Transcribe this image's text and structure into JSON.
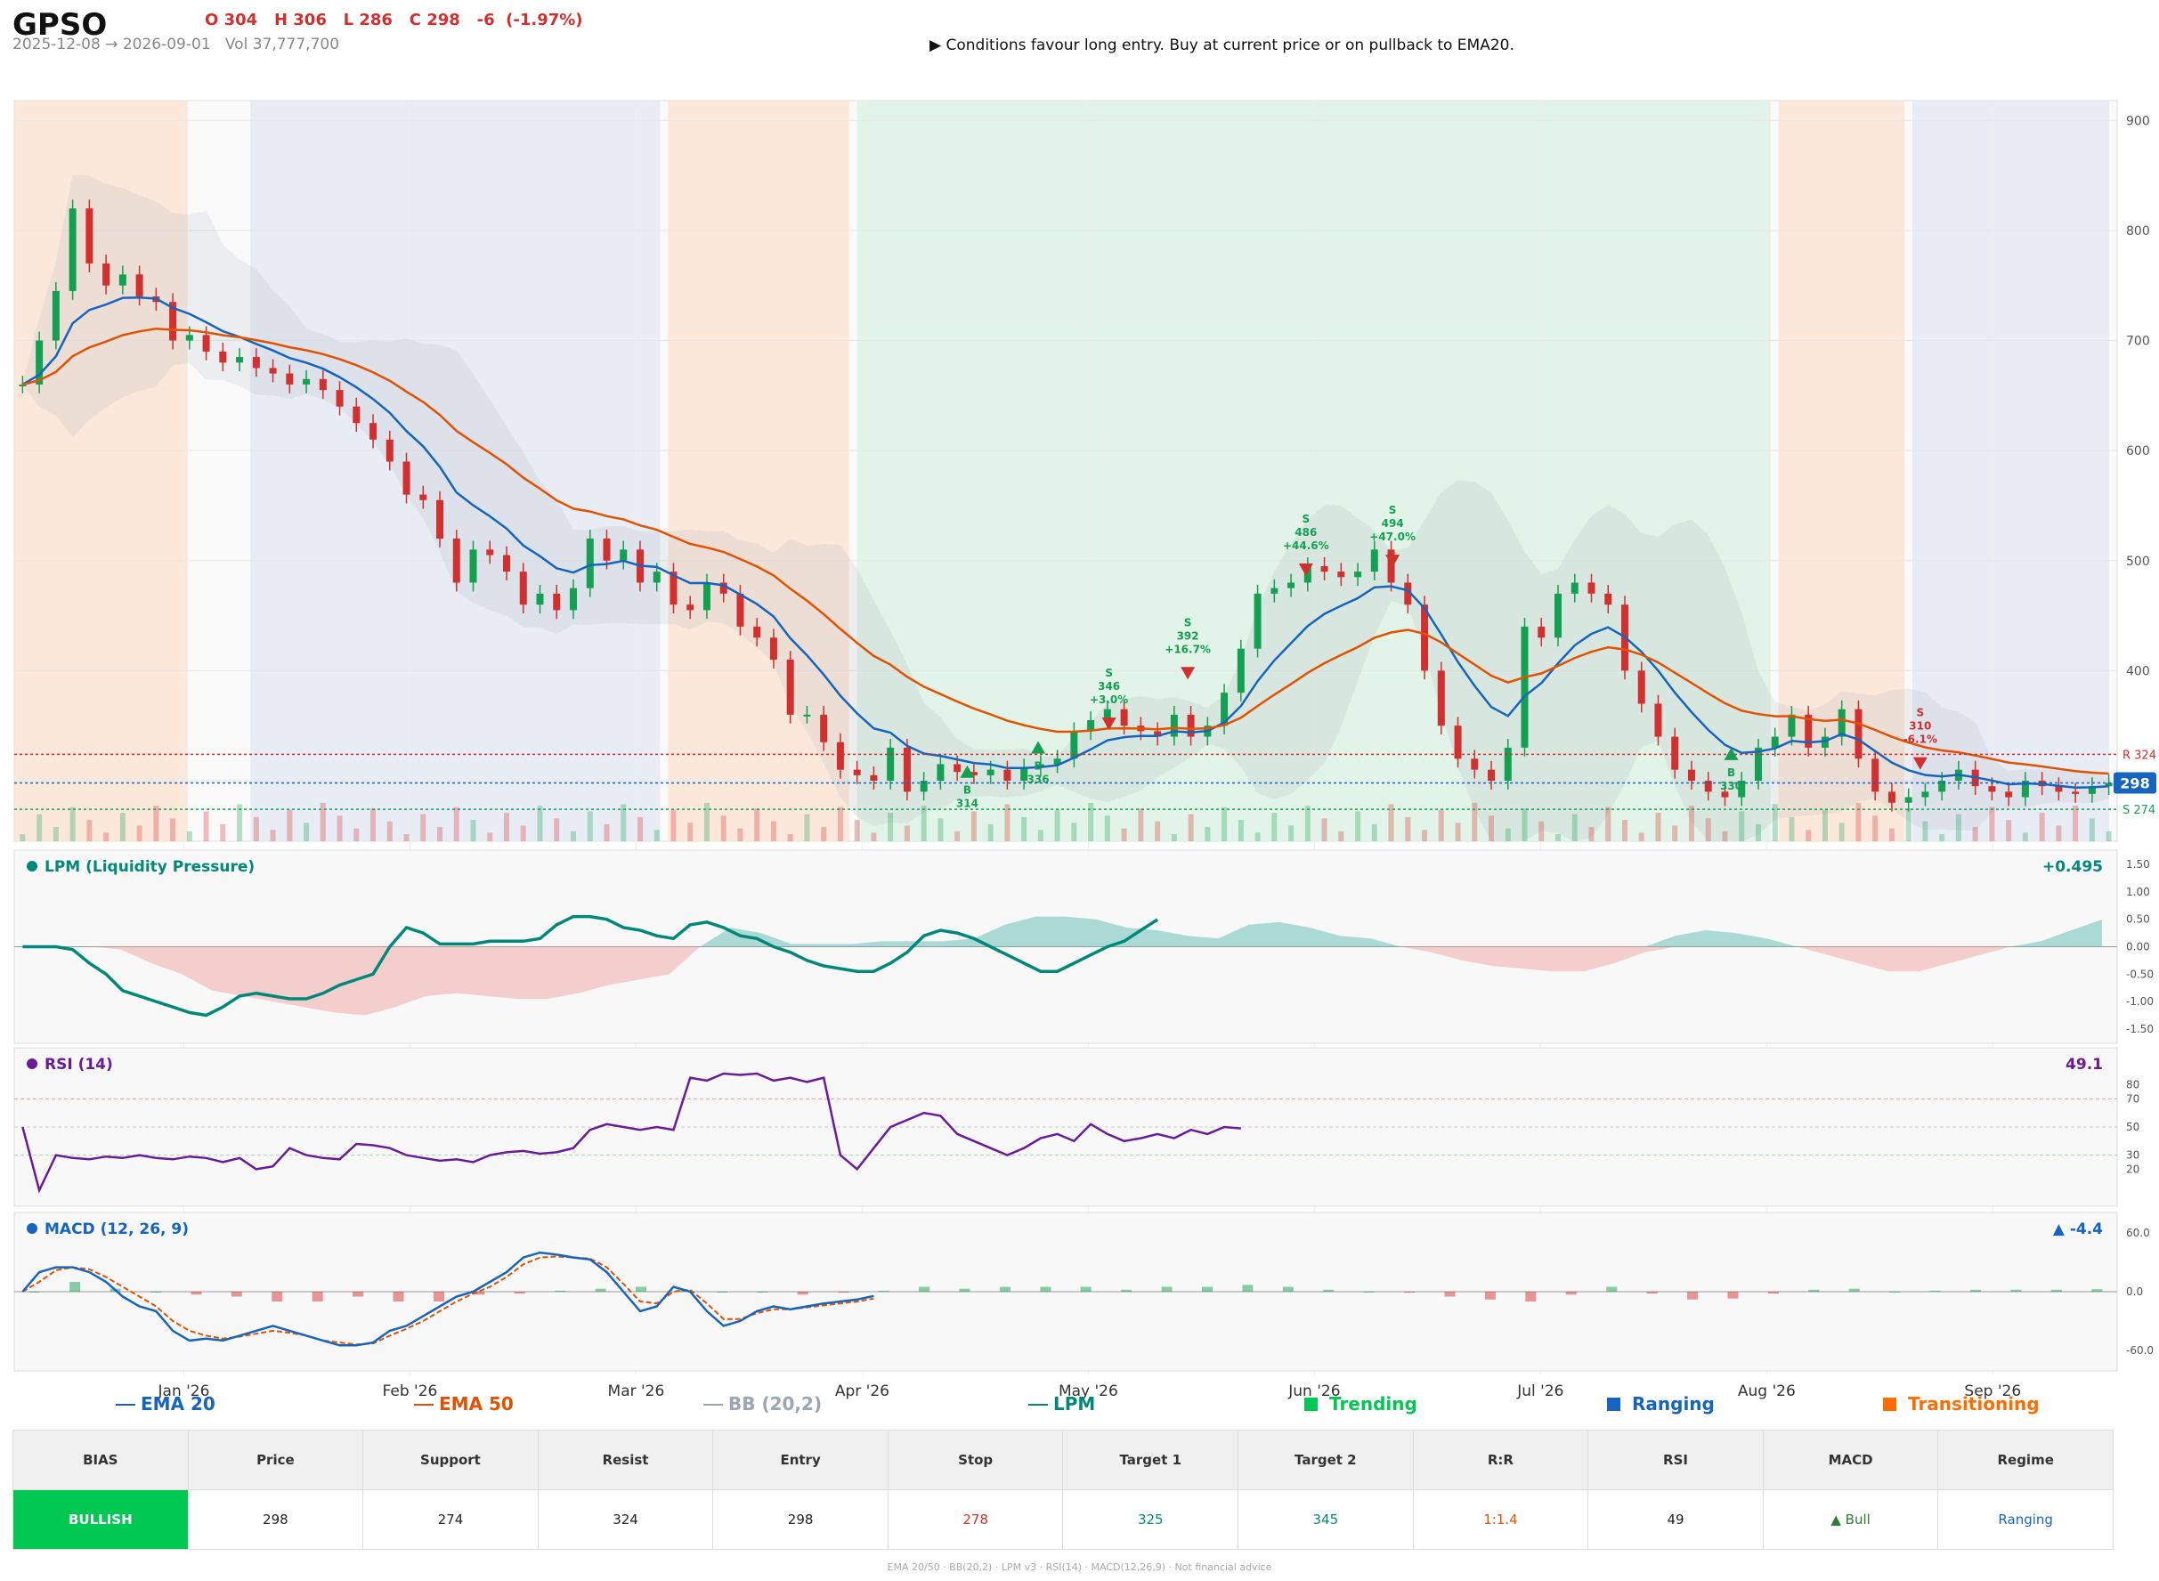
{
  "header": {
    "ticker": "GPSO",
    "ohlc": "O 304   H 306   L 286   C 298   -6  (-1.97%)",
    "range": "2025-12-08 → 2026-09-01   Vol 37,777,700",
    "signal": "▶  Conditions favour long entry. Buy at current price or on pullback to EMA20."
  },
  "colors": {
    "bull": "#13a052",
    "bear": "#d32f2f",
    "ema20": "#1565c0",
    "ema50": "#e65100",
    "lpm": "#00897b",
    "rsi": "#6a1b9a",
    "macd": "#1565c0",
    "signal": "#e65100",
    "trending": "#00c853",
    "ranging": "#1565c0",
    "transitioning": "#ff6d00"
  },
  "chart_data": [
    {
      "type": "candlestick",
      "title": "GPSO",
      "x_axis_ticks": [
        "Jan '26",
        "Feb '26",
        "Mar '26",
        "Apr '26",
        "May '26",
        "Jun '26",
        "Jul '26",
        "Aug '26",
        "Sep '26"
      ],
      "y_ticks": [
        300,
        400,
        500,
        600,
        700,
        800,
        900
      ],
      "ylim": [
        245,
        918
      ],
      "regimes": [
        {
          "name": "Transitioning",
          "from": "2025-12-08",
          "to": "2025-12-30"
        },
        {
          "name": "Ranging",
          "from": "2026-01-07",
          "to": "2026-02-28"
        },
        {
          "name": "Transitioning",
          "from": "2026-03-01",
          "to": "2026-03-24"
        },
        {
          "name": "Trending",
          "from": "2026-03-25",
          "to": "2026-07-19"
        },
        {
          "name": "Transitioning",
          "from": "2026-07-20",
          "to": "2026-08-05"
        },
        {
          "name": "Ranging",
          "from": "2026-08-06",
          "to": "2026-08-31"
        }
      ],
      "closes": [
        660,
        700,
        745,
        820,
        770,
        750,
        760,
        740,
        735,
        700,
        705,
        690,
        680,
        685,
        675,
        670,
        660,
        665,
        655,
        640,
        625,
        610,
        590,
        560,
        555,
        520,
        480,
        510,
        505,
        490,
        460,
        470,
        455,
        475,
        520,
        500,
        510,
        480,
        490,
        460,
        455,
        480,
        470,
        440,
        430,
        410,
        360,
        360,
        335,
        310,
        305,
        300,
        330,
        290,
        300,
        315,
        308,
        305,
        310,
        300,
        312,
        315,
        320,
        345,
        355,
        365,
        350,
        345,
        340,
        360,
        340,
        350,
        380,
        420,
        470,
        475,
        480,
        495,
        490,
        485,
        490,
        510,
        480,
        460,
        400,
        350,
        320,
        310,
        300,
        330,
        440,
        430,
        470,
        480,
        470,
        460,
        400,
        370,
        340,
        310,
        300,
        290,
        285,
        300,
        330,
        340,
        360,
        330,
        340,
        365,
        320,
        290,
        280,
        285,
        290,
        300,
        310,
        295,
        290,
        285,
        300,
        295,
        290,
        288,
        295,
        298
      ],
      "levels": {
        "resistance": 324,
        "support": 274,
        "price": 298,
        "resistance_label": "R 324",
        "support_label": "S 274",
        "price_label": "298"
      },
      "signals": [
        {
          "type": "S",
          "price": 346,
          "pct": "+3.0%",
          "date": "2026-04-26"
        },
        {
          "type": "S",
          "price": 392,
          "pct": "+16.7%",
          "date": "2026-05-06"
        },
        {
          "type": "S",
          "price": 486,
          "pct": "+44.6%",
          "date": "2026-05-21"
        },
        {
          "type": "S",
          "price": 494,
          "pct": "+47.0%",
          "date": "2026-06-01"
        },
        {
          "type": "B",
          "price": 314,
          "date": "2026-04-08"
        },
        {
          "type": "B",
          "price": 336,
          "date": "2026-04-17"
        },
        {
          "type": "B",
          "price": 330,
          "date": "2026-07-14"
        },
        {
          "type": "S",
          "price": 310,
          "pct": "-6.1%",
          "date": "2026-08-07"
        }
      ],
      "legend": [
        "EMA 20",
        "EMA 50",
        "BB (20,2)",
        "LPM",
        "Trending",
        "Ranging",
        "Transitioning"
      ]
    },
    {
      "type": "area",
      "title": "LPM (Liquidity Pressure)",
      "current": "+0.495",
      "y_ticks": [
        "1.50",
        "1.00",
        "0.50",
        "0.00",
        "-0.50",
        "-1.00",
        "-1.50"
      ],
      "ylim": [
        -1.6,
        1.6
      ],
      "values": [
        0,
        0,
        0,
        -0.05,
        -0.3,
        -0.5,
        -0.8,
        -0.9,
        -1.0,
        -1.1,
        -1.2,
        -1.25,
        -1.1,
        -0.9,
        -0.85,
        -0.9,
        -0.95,
        -0.95,
        -0.85,
        -0.7,
        -0.6,
        -0.5,
        0,
        0.35,
        0.25,
        0.05,
        0.05,
        0.05,
        0.1,
        0.1,
        0.1,
        0.15,
        0.4,
        0.55,
        0.55,
        0.5,
        0.35,
        0.3,
        0.2,
        0.15,
        0.4,
        0.45,
        0.35,
        0.2,
        0.15,
        0,
        -0.1,
        -0.25,
        -0.35,
        -0.4,
        -0.45,
        -0.45,
        -0.3,
        -0.1,
        0.2,
        0.3,
        0.25,
        0.15,
        0,
        -0.15,
        -0.3,
        -0.45,
        -0.45,
        -0.3,
        -0.15,
        0,
        0.1,
        0.3,
        0.495
      ]
    },
    {
      "type": "line",
      "title": "RSI (14)",
      "current": "49.1",
      "y_ticks": [
        "80",
        "70",
        "50",
        "30",
        "20"
      ],
      "ylim": [
        0,
        100
      ],
      "values": [
        50,
        5,
        30,
        28,
        27,
        29,
        28,
        30,
        28,
        27,
        29,
        28,
        25,
        28,
        20,
        22,
        35,
        30,
        28,
        27,
        38,
        37,
        35,
        30,
        28,
        26,
        27,
        25,
        30,
        32,
        33,
        31,
        32,
        35,
        48,
        52,
        50,
        48,
        50,
        48,
        85,
        83,
        88,
        87,
        88,
        83,
        85,
        82,
        85,
        30,
        20,
        35,
        50,
        55,
        60,
        58,
        45,
        40,
        35,
        30,
        35,
        42,
        45,
        40,
        52,
        45,
        40,
        42,
        45,
        42,
        48,
        45,
        50,
        49
      ]
    },
    {
      "type": "line",
      "title": "MACD (12, 26, 9)",
      "current": "▲ -4.4",
      "y_ticks": [
        "60.0",
        "0.0",
        "-60.0"
      ],
      "ylim": [
        -72,
        72
      ],
      "macd": [
        0,
        20,
        25,
        25,
        20,
        10,
        -5,
        -15,
        -20,
        -40,
        -50,
        -48,
        -50,
        -45,
        -40,
        -35,
        -40,
        -45,
        -50,
        -55,
        -55,
        -52,
        -40,
        -35,
        -25,
        -15,
        -5,
        0,
        10,
        20,
        35,
        40,
        38,
        35,
        33,
        20,
        0,
        -20,
        -15,
        5,
        0,
        -20,
        -35,
        -30,
        -20,
        -15,
        -18,
        -15,
        -12,
        -10,
        -8,
        -4.4
      ],
      "signal": [
        0,
        10,
        22,
        25,
        23,
        15,
        5,
        -5,
        -15,
        -30,
        -40,
        -45,
        -48,
        -46,
        -43,
        -40,
        -42,
        -45,
        -50,
        -52,
        -54,
        -53,
        -45,
        -38,
        -30,
        -20,
        -10,
        -2,
        5,
        15,
        28,
        35,
        36,
        35,
        34,
        25,
        8,
        -10,
        -12,
        0,
        2,
        -12,
        -28,
        -28,
        -22,
        -18,
        -18,
        -16,
        -14,
        -12,
        -10,
        -7
      ],
      "histogram": [
        0,
        10,
        3,
        0,
        -3,
        -5,
        -10,
        -10,
        -5,
        -10,
        -10,
        -3,
        -2,
        1,
        3,
        5,
        2,
        0,
        0,
        -3,
        -1,
        1,
        5,
        3,
        5,
        5,
        5,
        2,
        5,
        5,
        7,
        5,
        2,
        0,
        -1,
        -5,
        -8,
        -10,
        -3,
        5,
        -2,
        -8,
        -7,
        -2,
        2,
        3,
        0,
        1,
        2,
        2,
        2,
        2.6
      ]
    }
  ],
  "table": {
    "headers": [
      "BIAS",
      "Price",
      "Support",
      "Resist",
      "Entry",
      "Stop",
      "Target 1",
      "Target 2",
      "R:R",
      "RSI",
      "MACD",
      "Regime"
    ],
    "values": [
      "BULLISH",
      "298",
      "274",
      "324",
      "298",
      "278",
      "325",
      "345",
      "1:1.4",
      "49",
      "▲ Bull",
      "Ranging"
    ]
  },
  "footnote": "EMA 20/50  ·  BB(20,2)  ·  LPM v3  ·  RSI(14)  ·  MACD(12,26,9)  ·  Not financial advice"
}
